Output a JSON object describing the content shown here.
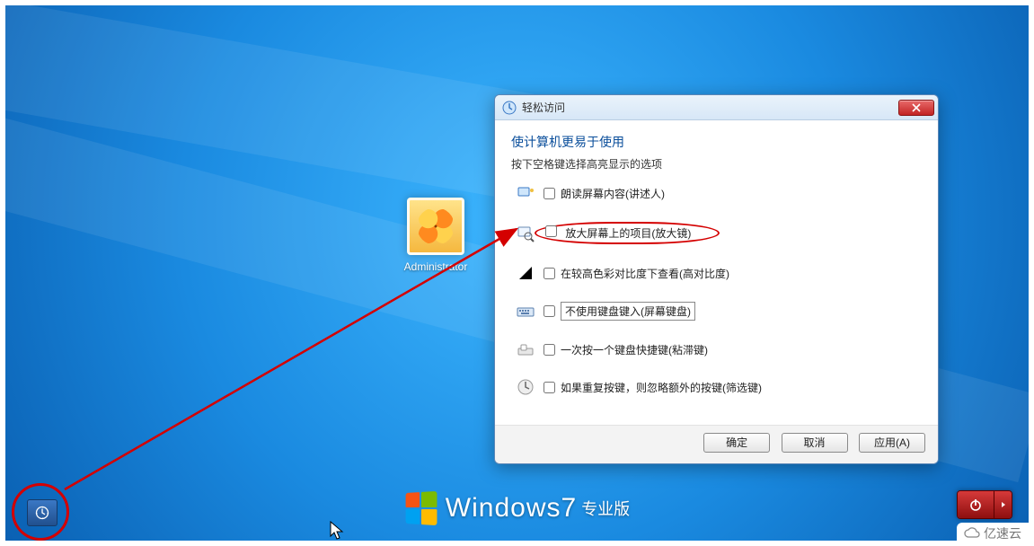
{
  "user": {
    "name": "Administrator"
  },
  "dialog": {
    "title": "轻松访问",
    "heading": "使计算机更易于使用",
    "subtitle": "按下空格键选择高亮显示的选项",
    "options": {
      "narrator": "朗读屏幕内容(讲述人)",
      "magnifier": "放大屏幕上的项目(放大镜)",
      "highcontrast": "在较高色彩对比度下查看(高对比度)",
      "osk": "不使用键盘键入(屏幕键盘)",
      "sticky": "一次按一个键盘快捷键(粘滞键)",
      "filter": "如果重复按键，则忽略额外的按键(筛选键)"
    },
    "buttons": {
      "ok": "确定",
      "cancel": "取消",
      "apply": "应用(A)"
    }
  },
  "branding": {
    "name": "Windows",
    "version": "7",
    "edition": "专业版"
  },
  "watermark": "亿速云"
}
